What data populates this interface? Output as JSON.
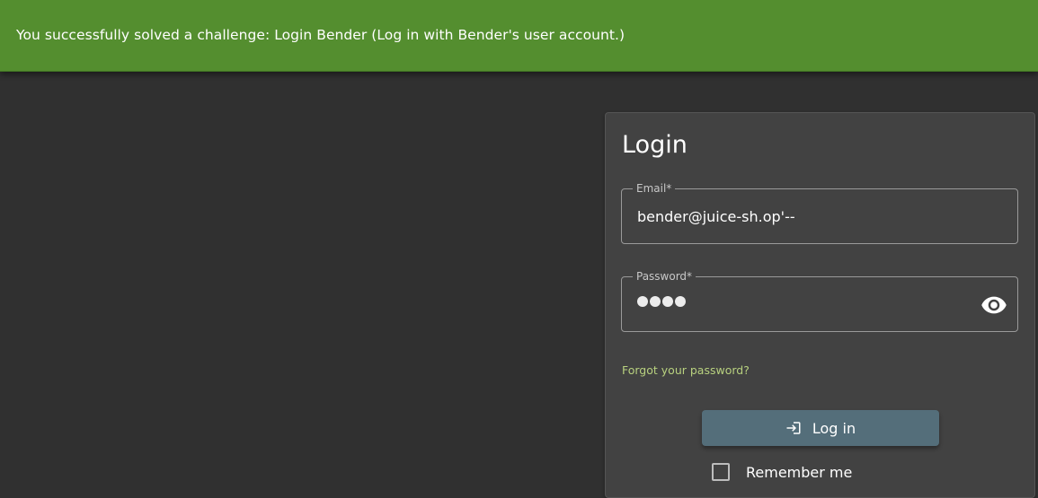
{
  "notification": {
    "message": "You successfully solved a challenge: Login Bender (Log in with Bender's user account.)",
    "color": "#548e2f"
  },
  "login": {
    "title": "Login",
    "email": {
      "label": "Email*",
      "value": "bender@juice-sh.op'--"
    },
    "password": {
      "label": "Password*",
      "masked_length": 4,
      "toggle_icon": "eye-icon"
    },
    "forgot_password_label": "Forgot your password?",
    "login_button": {
      "label": "Log in",
      "icon": "login-icon",
      "color": "#546e7a"
    },
    "remember_me": {
      "label": "Remember me",
      "checked": false
    }
  }
}
